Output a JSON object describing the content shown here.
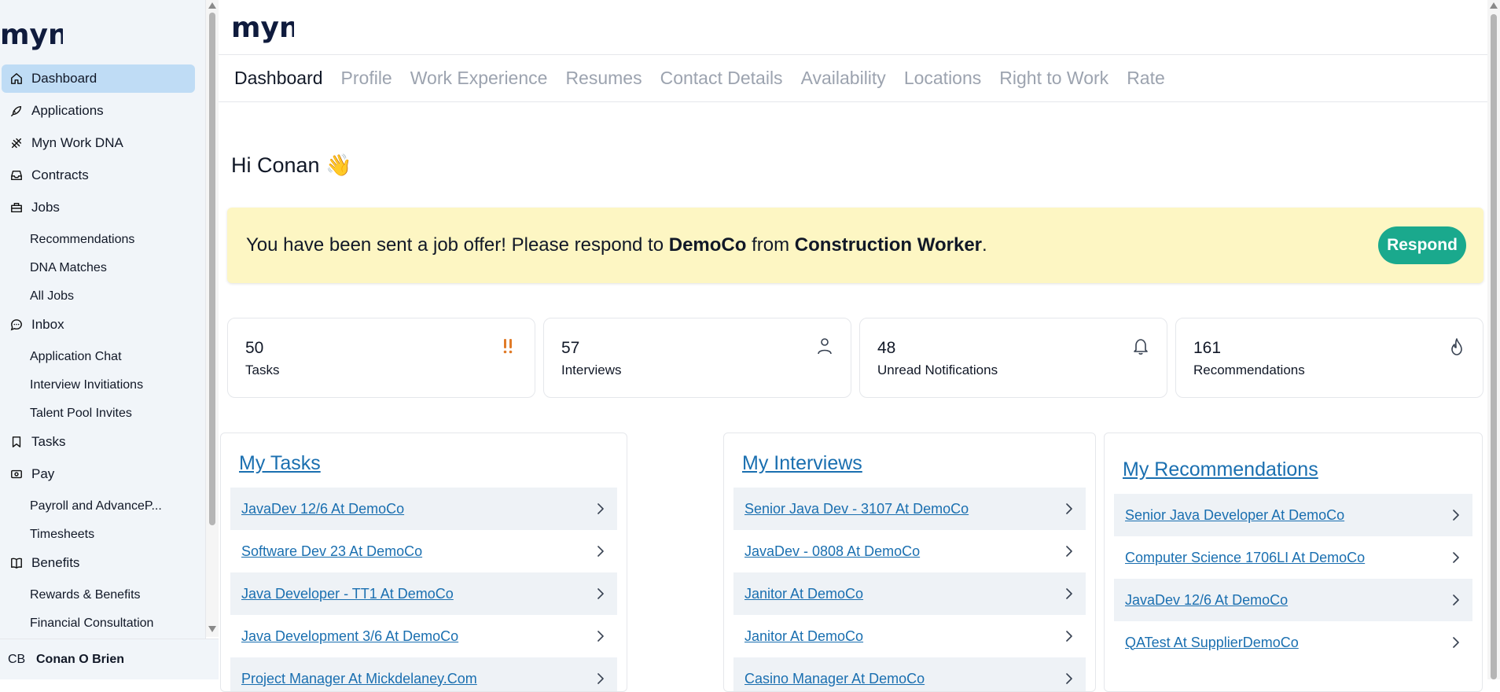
{
  "brand": {
    "logo_text": "myn"
  },
  "sidebar": {
    "items": [
      {
        "label": "Dashboard",
        "icon": "home-icon",
        "active": true
      },
      {
        "label": "Applications",
        "icon": "rocket-icon"
      },
      {
        "label": "Myn Work DNA",
        "icon": "dna-icon"
      },
      {
        "label": "Contracts",
        "icon": "inbox-tray-icon"
      },
      {
        "label": "Jobs",
        "icon": "briefcase-icon"
      },
      {
        "label": "Recommendations",
        "sub": true
      },
      {
        "label": "DNA Matches",
        "sub": true
      },
      {
        "label": "All Jobs",
        "sub": true
      },
      {
        "label": "Inbox",
        "icon": "chat-bubble-icon"
      },
      {
        "label": "Application Chat",
        "sub": true
      },
      {
        "label": "Interview Invitiations",
        "sub": true
      },
      {
        "label": "Talent Pool Invites",
        "sub": true
      },
      {
        "label": "Tasks",
        "icon": "bookmark-icon"
      },
      {
        "label": "Pay",
        "icon": "money-icon"
      },
      {
        "label": "Payroll and AdvanceP...",
        "sub": true
      },
      {
        "label": "Timesheets",
        "sub": true
      },
      {
        "label": "Benefits",
        "icon": "book-open-icon"
      },
      {
        "label": "Rewards & Benefits",
        "sub": true
      },
      {
        "label": "Financial Consultation",
        "sub": true
      }
    ]
  },
  "user": {
    "initials": "CB",
    "name": "Conan O Brien"
  },
  "tabs": [
    {
      "label": "Dashboard",
      "active": true
    },
    {
      "label": "Profile"
    },
    {
      "label": "Work Experience"
    },
    {
      "label": "Resumes"
    },
    {
      "label": "Contact Details"
    },
    {
      "label": "Availability"
    },
    {
      "label": "Locations"
    },
    {
      "label": "Right to Work"
    },
    {
      "label": "Rate"
    }
  ],
  "greeting": "Hi Conan 👋",
  "banner": {
    "prefix": "You have been sent a job offer! Please respond to ",
    "company": "DemoCo",
    "middle": " from ",
    "job": "Construction Worker",
    "suffix": ".",
    "button": "Respond"
  },
  "stats": [
    {
      "value": "50",
      "label": "Tasks",
      "icon": "double-exclamation-icon",
      "color": "#e07b28"
    },
    {
      "value": "57",
      "label": "Interviews",
      "icon": "person-icon"
    },
    {
      "value": "48",
      "label": "Unread Notifications",
      "icon": "bell-icon"
    },
    {
      "value": "161",
      "label": "Recommendations",
      "icon": "flame-icon"
    }
  ],
  "panels": {
    "tasks": {
      "title": "My Tasks",
      "rows": [
        "JavaDev 12/6 At DemoCo",
        "Software Dev 23 At DemoCo",
        "Java Developer - TT1 At DemoCo",
        "Java Development 3/6 At DemoCo",
        "Project Manager At Mickdelaney.Com"
      ]
    },
    "interviews": {
      "title": "My Interviews",
      "rows": [
        "Senior Java Dev - 3107 At DemoCo",
        "JavaDev - 0808 At DemoCo",
        "Janitor At DemoCo",
        "Janitor At DemoCo",
        "Casino Manager At DemoCo"
      ]
    },
    "recommendations": {
      "title": "My Recommendations",
      "rows": [
        "Senior Java Developer At DemoCo",
        "Computer Science 1706LI At DemoCo",
        "JavaDev 12/6 At DemoCo",
        "QATest At SupplierDemoCo"
      ]
    }
  },
  "colors": {
    "accent": "#1aa98d",
    "link": "#1a6fb0",
    "banner_bg": "#fdf6c3",
    "active_nav": "#bfdcf5"
  }
}
